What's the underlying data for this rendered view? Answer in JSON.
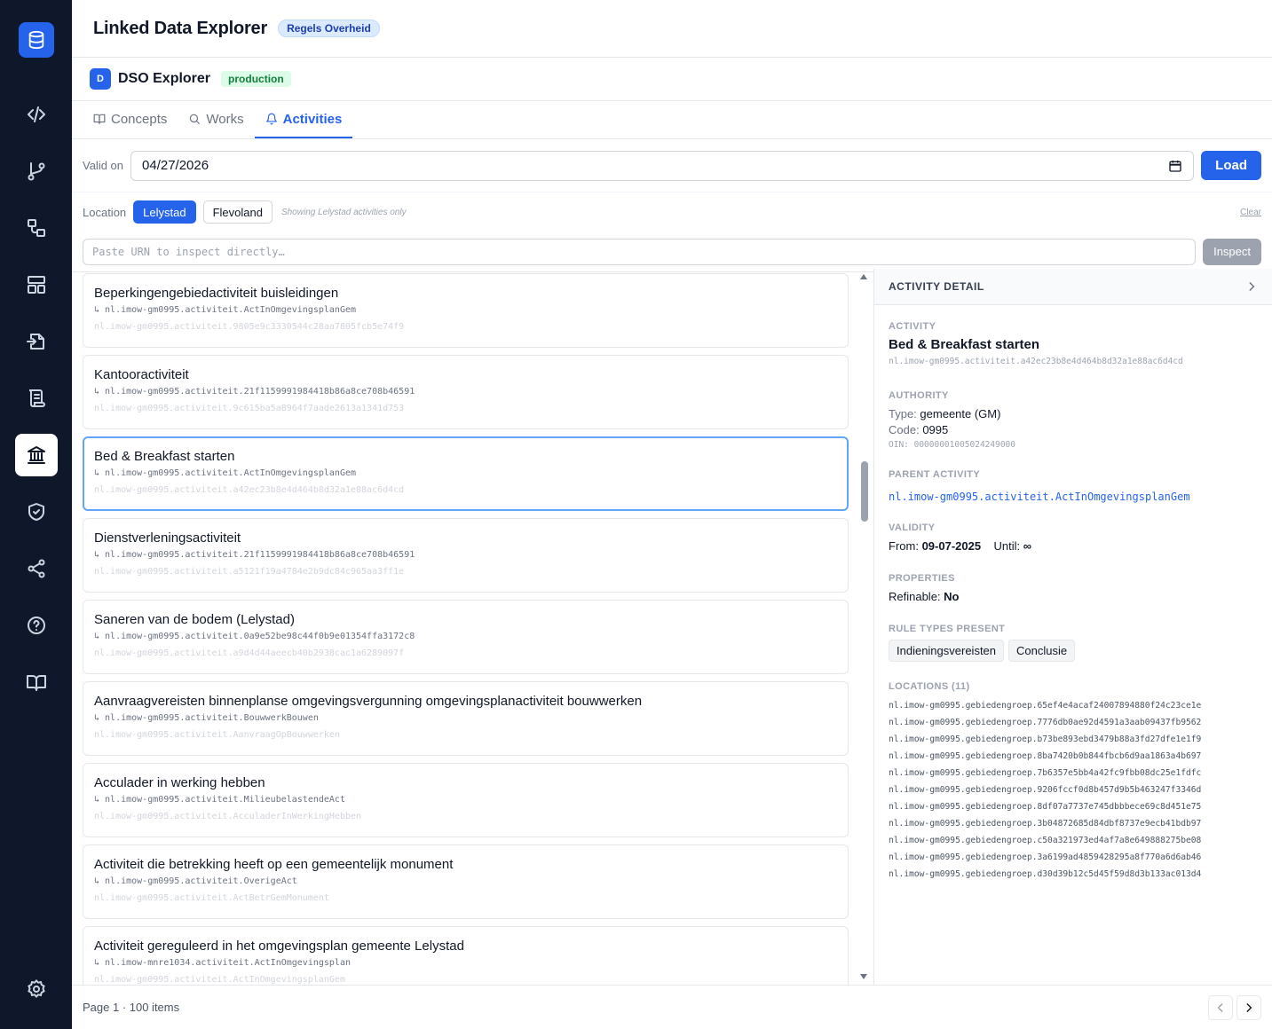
{
  "header": {
    "title": "Linked Data Explorer",
    "badge": "Regels Overheid"
  },
  "dataset": {
    "avatar": "D",
    "name": "DSO Explorer",
    "env": "production"
  },
  "tabs": [
    {
      "label": "Concepts",
      "icon": "book-icon"
    },
    {
      "label": "Works",
      "icon": "search-icon"
    },
    {
      "label": "Activities",
      "icon": "bell-icon",
      "active": true
    }
  ],
  "filters": {
    "valid_on_label": "Valid on",
    "valid_on_value": "04/27/2026",
    "load_label": "Load",
    "location_label": "Location",
    "locations": [
      "Lelystad",
      "Flevoland"
    ],
    "active_location": "Lelystad",
    "hint": "Showing Lelystad activities only",
    "clear_label": "Clear",
    "urn_placeholder": "Paste URN to inspect directly…",
    "inspect_label": "Inspect"
  },
  "activities": [
    {
      "title": "Beperkingengebiedactiviteit buisleidingen",
      "parent": "↳ nl.imow-gm0995.activiteit.ActInOmgevingsplanGem",
      "id": "nl.imow-gm0995.activiteit.9805e9c3330544c28aa7805fcb5e74f9"
    },
    {
      "title": "Kantooractiviteit",
      "parent": "↳ nl.imow-gm0995.activiteit.21f1159991984418b86a8ce708b46591",
      "id": "nl.imow-gm0995.activiteit.9c615ba5a8964f7aade2613a1341d753"
    },
    {
      "title": "Bed & Breakfast starten",
      "parent": "↳ nl.imow-gm0995.activiteit.ActInOmgevingsplanGem",
      "id": "nl.imow-gm0995.activiteit.a42ec23b8e4d464b8d32a1e88ac6d4cd",
      "selected": true
    },
    {
      "title": "Dienstverleningsactiviteit",
      "parent": "↳ nl.imow-gm0995.activiteit.21f1159991984418b86a8ce708b46591",
      "id": "nl.imow-gm0995.activiteit.a5121f19a4784e2b9dc84c965aa3ff1e"
    },
    {
      "title": "Saneren van de bodem (Lelystad)",
      "parent": "↳ nl.imow-gm0995.activiteit.0a9e52be98c44f0b9e01354ffa3172c8",
      "id": "nl.imow-gm0995.activiteit.a9d4d44aeecb40b2938cac1a6289097f"
    },
    {
      "title": "Aanvraagvereisten binnenplanse omgevingsvergunning omgevingsplanactiviteit bouwwerken",
      "parent": "↳ nl.imow-gm0995.activiteit.BouwwerkBouwen",
      "id": "nl.imow-gm0995.activiteit.AanvraagOpBouwwerken"
    },
    {
      "title": "Acculader in werking hebben",
      "parent": "↳ nl.imow-gm0995.activiteit.MilieubelastendeAct",
      "id": "nl.imow-gm0995.activiteit.AcculaderInWerkingHebben"
    },
    {
      "title": "Activiteit die betrekking heeft op een gemeentelijk monument",
      "parent": "↳ nl.imow-gm0995.activiteit.OverigeAct",
      "id": "nl.imow-gm0995.activiteit.ActBetrGemMonument"
    },
    {
      "title": "Activiteit gereguleerd in het omgevingsplan gemeente Lelystad",
      "parent": "↳ nl.imow-mnre1034.activiteit.ActInOmgevingsplan",
      "id": "nl.imow-gm0995.activiteit.ActInOmgevingsplanGem"
    }
  ],
  "detail": {
    "header": "ACTIVITY DETAIL",
    "activity_label": "ACTIVITY",
    "activity_title": "Bed & Breakfast starten",
    "activity_id": "nl.imow-gm0995.activiteit.a42ec23b8e4d464b8d32a1e88ac6d4cd",
    "authority_label": "AUTHORITY",
    "type_key": "Type:",
    "type_val": "gemeente (GM)",
    "code_key": "Code:",
    "code_val": "0995",
    "oin": "OIN: 00000001005024249000",
    "parent_label": "PARENT ACTIVITY",
    "parent_link": "nl.imow-gm0995.activiteit.ActInOmgevingsplanGem",
    "validity_label": "VALIDITY",
    "from_key": "From:",
    "from_val": "09-07-2025",
    "until_key": "Until:",
    "until_val": "∞",
    "properties_label": "PROPERTIES",
    "refinable_key": "Refinable:",
    "refinable_val": "No",
    "ruletypes_label": "RULE TYPES PRESENT",
    "ruletypes": [
      "Indieningsvereisten",
      "Conclusie"
    ],
    "locations_label": "LOCATIONS (11)",
    "locations": [
      "nl.imow-gm0995.gebiedengroep.65ef4e4acaf24007894880f24c23ce1e",
      "nl.imow-gm0995.gebiedengroep.7776db0ae92d4591a3aab09437fb9562",
      "nl.imow-gm0995.gebiedengroep.b73be893ebd3479b88a3fd27dfe1e1f9",
      "nl.imow-gm0995.gebiedengroep.8ba7420b0b844fbcb6d9aa1863a4b697",
      "nl.imow-gm0995.gebiedengroep.7b6357e5bb4a42fc9fbb08dc25e1fdfc",
      "nl.imow-gm0995.gebiedengroep.9206fccf0d8b457d9b5b463247f3346d",
      "nl.imow-gm0995.gebiedengroep.8df07a7737e745dbbbece69c8d451e75",
      "nl.imow-gm0995.gebiedengroep.3b04872685d84dbf8737e9ecb41bdb97",
      "nl.imow-gm0995.gebiedengroep.c50a321973ed4af7a8e649888275be08",
      "nl.imow-gm0995.gebiedengroep.3a6199ad4859428295a8f770a6d6ab46",
      "nl.imow-gm0995.gebiedengroep.d30d39b12c5d45f59d8d3b133ac013d4"
    ]
  },
  "footer": {
    "pager": "Page 1 · 100 items"
  },
  "sidebar": {
    "icons": [
      "database-icon",
      "code-icon",
      "git-branch-icon",
      "shapes-icon",
      "layout-icon",
      "file-import-icon",
      "scroll-icon",
      "landmark-icon",
      "shield-check-icon",
      "share-icon",
      "help-icon",
      "book-open-icon",
      "settings-icon"
    ],
    "active": "landmark-icon"
  },
  "colors": {
    "accent": "#2563eb",
    "sidebar_bg": "#0f172a",
    "success": "#15803d"
  }
}
